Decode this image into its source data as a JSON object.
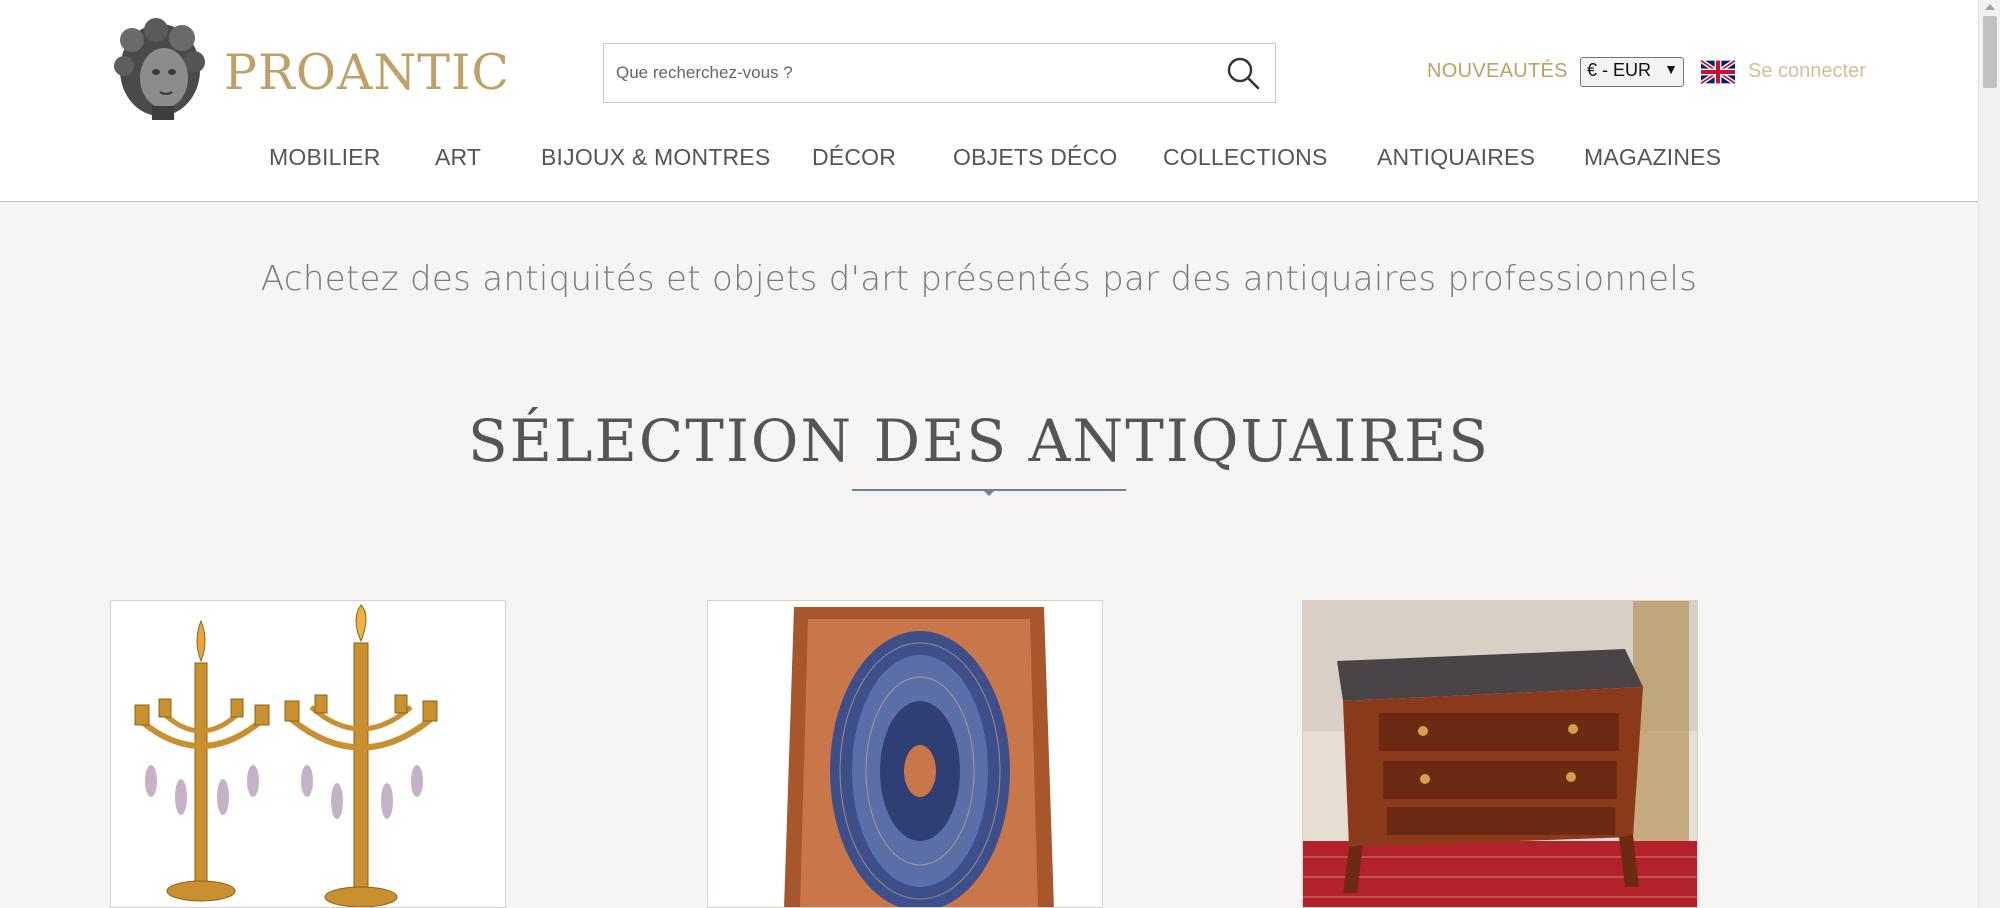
{
  "brand": {
    "name": "PROANTIC",
    "logo_icon": "sculpted-head-logo"
  },
  "search": {
    "placeholder": "Que recherchez-vous ?",
    "value": "",
    "icon": "search-icon"
  },
  "header_links": {
    "new_label": "NOUVEAUTÉS",
    "currency": "€ - EUR",
    "language_icon": "uk-flag-icon",
    "login_label": "Se connecter"
  },
  "nav": {
    "items": [
      {
        "label": "MOBILIER"
      },
      {
        "label": "ART"
      },
      {
        "label": "BIJOUX & MONTRES"
      },
      {
        "label": "DÉCOR"
      },
      {
        "label": "OBJETS DÉCO"
      },
      {
        "label": "COLLECTIONS"
      },
      {
        "label": "ANTIQUAIRES"
      },
      {
        "label": "MAGAZINES"
      }
    ]
  },
  "tagline": "Achetez des antiquités et objets d'art présentés par des antiquaires professionnels",
  "selection": {
    "title": "SÉLECTION DES ANTIQUAIRES",
    "products": [
      {
        "image": "gilt-bronze-candelabra-pair"
      },
      {
        "image": "persian-silk-rug"
      },
      {
        "image": "marquetry-commode-marble-top"
      }
    ]
  },
  "colors": {
    "brand_gold": "#bfa065",
    "login_gold": "#d4bf95",
    "background": "#f7f5f4",
    "divider": "#6f8294"
  }
}
